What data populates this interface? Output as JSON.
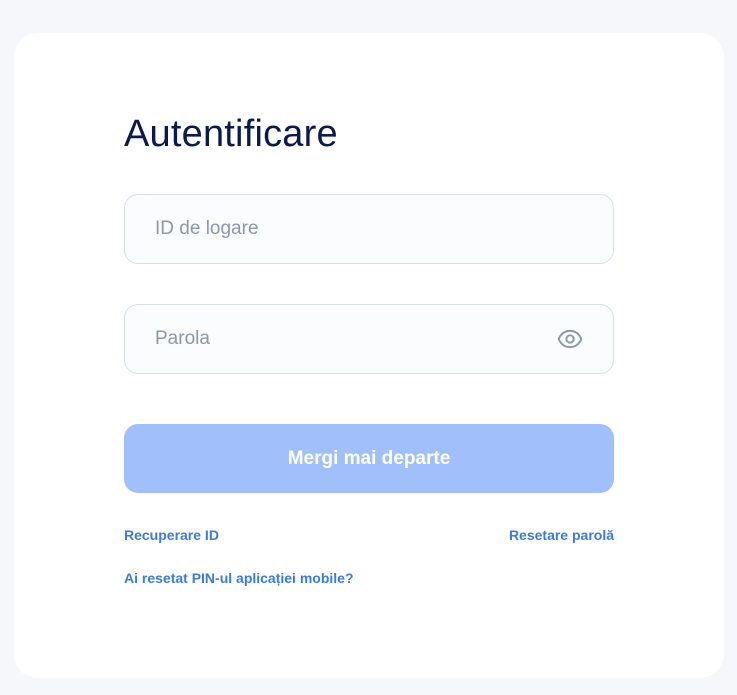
{
  "login": {
    "title": "Autentificare",
    "id_field": {
      "placeholder": "ID de logare",
      "value": ""
    },
    "password_field": {
      "placeholder": "Parola",
      "value": "",
      "toggle_icon": "eye-icon"
    },
    "submit_label": "Mergi mai departe",
    "links": {
      "recover_id": "Recuperare ID",
      "reset_password": "Resetare parolă",
      "reset_pin": "Ai resetat PIN-ul aplicației mobile?"
    }
  },
  "colors": {
    "page_background": "#f6f7fb",
    "card_background": "#ffffff",
    "title": "#0b1a4a",
    "field_border": "#d6e0ec",
    "placeholder": "#8b97ad",
    "button_disabled": "#a1c0fb",
    "link": "#3d7bd9"
  }
}
